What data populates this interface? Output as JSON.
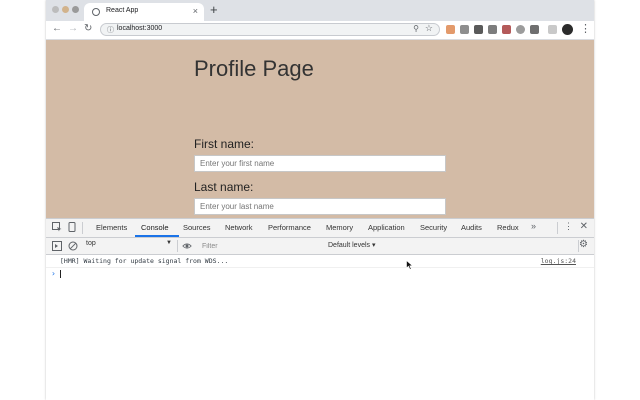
{
  "browser": {
    "tab_title": "React App",
    "tab_close": "×",
    "new_tab": "+",
    "url": "localhost:3000",
    "back": "←",
    "forward": "→",
    "reload": "↻",
    "info": "ⓘ",
    "zoom": "⚲",
    "star": "☆",
    "menu": "⋮"
  },
  "page": {
    "title": "Profile Page",
    "first_name_label": "First name:",
    "first_name_placeholder": "Enter your first name",
    "last_name_label": "Last name:",
    "last_name_placeholder": "Enter your last name",
    "background": "#d3bba6"
  },
  "devtools": {
    "tabs": [
      "Elements",
      "Console",
      "Sources",
      "Network",
      "Performance",
      "Memory",
      "Application",
      "Security",
      "Audits",
      "Redux"
    ],
    "active_tab": "Console",
    "more": "»",
    "close": "✕",
    "menu": "⋮",
    "context": "top",
    "filter_placeholder": "Filter",
    "levels": "Default levels ▾",
    "log": {
      "message": "[HMR] Waiting for update signal from WDS...",
      "source": "log.js:24"
    },
    "prompt": "›",
    "accent": "#1a73e8"
  }
}
